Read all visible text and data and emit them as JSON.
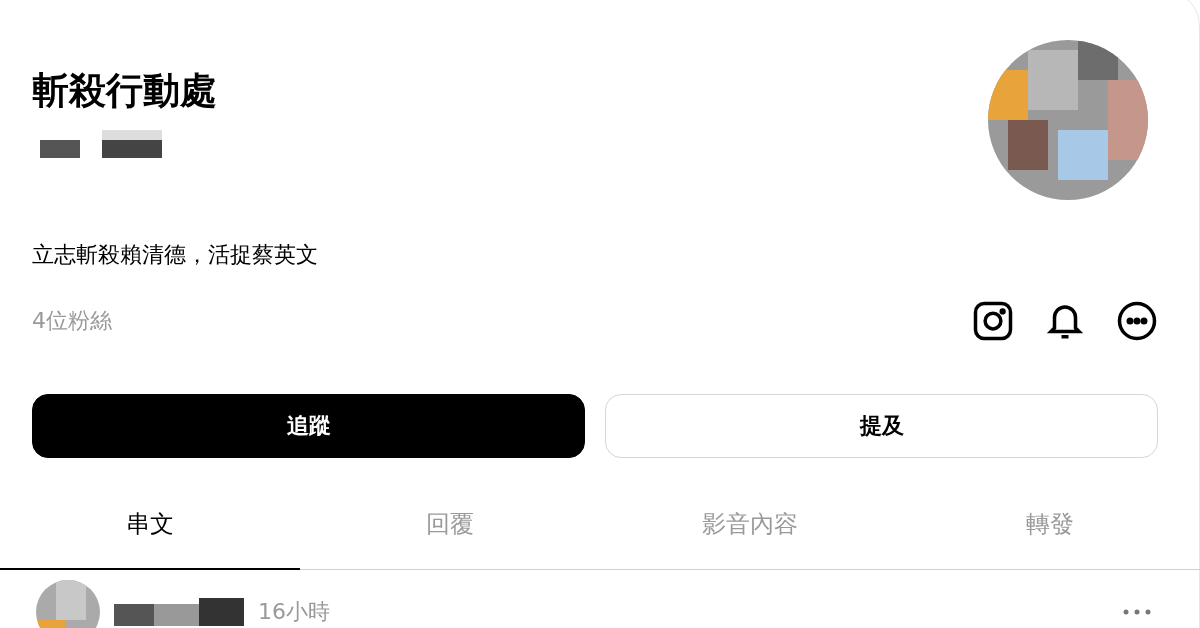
{
  "profile": {
    "name": "斬殺行動處",
    "bio": "立志斬殺賴清德，活捉蔡英文",
    "followers": "4位粉絲"
  },
  "buttons": [
    {
      "label": "追蹤",
      "kind": "primary"
    },
    {
      "label": "提及",
      "kind": "secondary"
    }
  ],
  "tabs": [
    {
      "label": "串文",
      "selected": true
    },
    {
      "label": "回覆",
      "selected": false
    },
    {
      "label": "影音內容",
      "selected": false
    },
    {
      "label": "轉發",
      "selected": false
    }
  ],
  "post": {
    "time": "16小時"
  }
}
